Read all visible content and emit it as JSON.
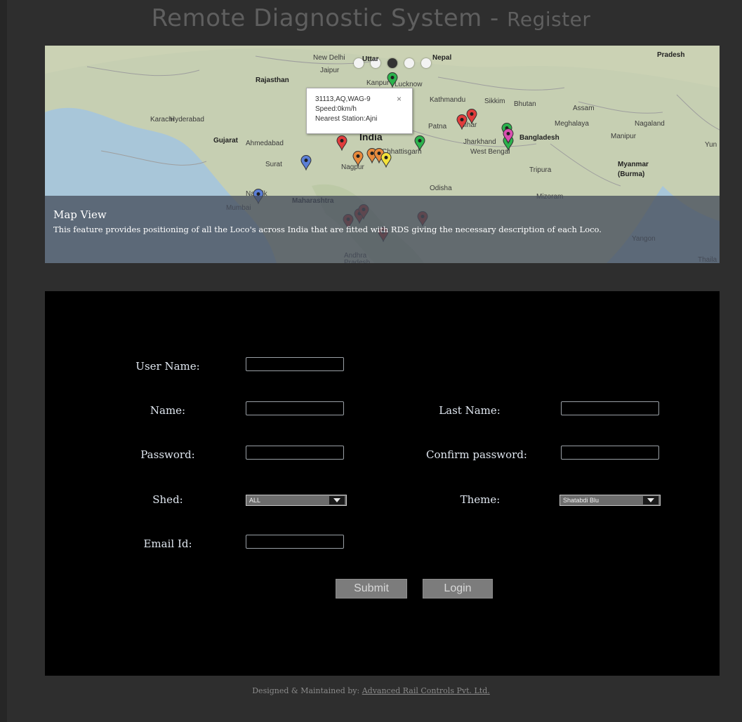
{
  "header": {
    "title_main": "Remote Diagnostic System - ",
    "title_sub": "Register"
  },
  "map": {
    "slider_dots": 5,
    "active_dot": 2,
    "labels": [
      {
        "text": "New Delhi",
        "style": ""
      },
      {
        "text": "Uttar",
        "style": "bold"
      },
      {
        "text": "Nepal",
        "style": "bold"
      },
      {
        "text": "Pradesh",
        "style": "bold"
      },
      {
        "text": "Rajasthan",
        "style": "bold"
      },
      {
        "text": "Jaipur",
        "style": ""
      },
      {
        "text": "Kanpur",
        "style": ""
      },
      {
        "text": "Lucknow",
        "style": ""
      },
      {
        "text": "Kathmandu",
        "style": ""
      },
      {
        "text": "Sikkim",
        "style": ""
      },
      {
        "text": "Bhutan",
        "style": ""
      },
      {
        "text": "Assam",
        "style": ""
      },
      {
        "text": "Nagaland",
        "style": ""
      },
      {
        "text": "Karachi",
        "style": ""
      },
      {
        "text": "Hyderabad",
        "style": ""
      },
      {
        "text": "Patna",
        "style": ""
      },
      {
        "text": "Bihar",
        "style": ""
      },
      {
        "text": "Meghalaya",
        "style": ""
      },
      {
        "text": "Manipur",
        "style": ""
      },
      {
        "text": "Jharkhand",
        "style": ""
      },
      {
        "text": "Bangladesh",
        "style": "bold"
      },
      {
        "text": "Yun",
        "style": ""
      },
      {
        "text": "Gujarat",
        "style": "bold"
      },
      {
        "text": "Ahmedabad",
        "style": ""
      },
      {
        "text": "India",
        "style": "big"
      },
      {
        "text": "Chhattisgarh",
        "style": ""
      },
      {
        "text": "West Bengal",
        "style": ""
      },
      {
        "text": "Nagpur",
        "style": ""
      },
      {
        "text": "Surat",
        "style": ""
      },
      {
        "text": "Tripura",
        "style": ""
      },
      {
        "text": "Myanmar",
        "style": "bold"
      },
      {
        "text": "(Burma)",
        "style": "bold"
      },
      {
        "text": "Odisha",
        "style": ""
      },
      {
        "text": "Nashik",
        "style": ""
      },
      {
        "text": "Maharashtra",
        "style": "bold"
      },
      {
        "text": "Mizoram",
        "style": ""
      },
      {
        "text": "Mumbai",
        "style": ""
      },
      {
        "text": "Andhra",
        "style": ""
      },
      {
        "text": "Pradesh",
        "style": ""
      },
      {
        "text": "Yangon",
        "style": ""
      },
      {
        "text": "Thaila",
        "style": ""
      }
    ],
    "markers": [
      {
        "color": "#2bb24c"
      },
      {
        "color": "#2bb24c"
      },
      {
        "color": "#e03c3c"
      },
      {
        "color": "#e03c3c"
      },
      {
        "color": "#2bb24c"
      },
      {
        "color": "#2bb24c"
      },
      {
        "color": "#d94fb0"
      },
      {
        "color": "#e03c3c"
      },
      {
        "color": "#5b7fd6"
      },
      {
        "color": "#e88a3c"
      },
      {
        "color": "#e88a3c"
      },
      {
        "color": "#e88a3c"
      },
      {
        "color": "#f3e23a"
      },
      {
        "color": "#5b7fd6"
      },
      {
        "color": "#b03020"
      },
      {
        "color": "#b03020"
      },
      {
        "color": "#b03020"
      },
      {
        "color": "#b03020"
      },
      {
        "color": "#b03020"
      }
    ],
    "popup": {
      "line1": "31113,AQ,WAG-9",
      "line2": "Speed:0km/h",
      "line3": "Nearest Station:Ajni",
      "close": "×"
    },
    "caption_title": "Map View",
    "caption_text": "This feature provides positioning of all the Loco's across India that are fitted with RDS giving the necessary description of each Loco."
  },
  "form": {
    "user_name_label": "User Name:",
    "name_label": "Name:",
    "last_name_label": "Last Name:",
    "password_label": "Password:",
    "confirm_password_label": "Confirm password:",
    "shed_label": "Shed:",
    "shed_value": "ALL",
    "theme_label": "Theme:",
    "theme_value": "Shatabdi Blu",
    "email_label": "Email Id:",
    "user_name_value": "",
    "name_value": "",
    "last_name_value": "",
    "password_value": "",
    "confirm_password_value": "",
    "email_value": "",
    "submit_label": "Submit",
    "login_label": "Login"
  },
  "footer": {
    "prefix": "Designed & Maintained by: ",
    "link": "Advanced Rail Controls Pvt. Ltd."
  }
}
